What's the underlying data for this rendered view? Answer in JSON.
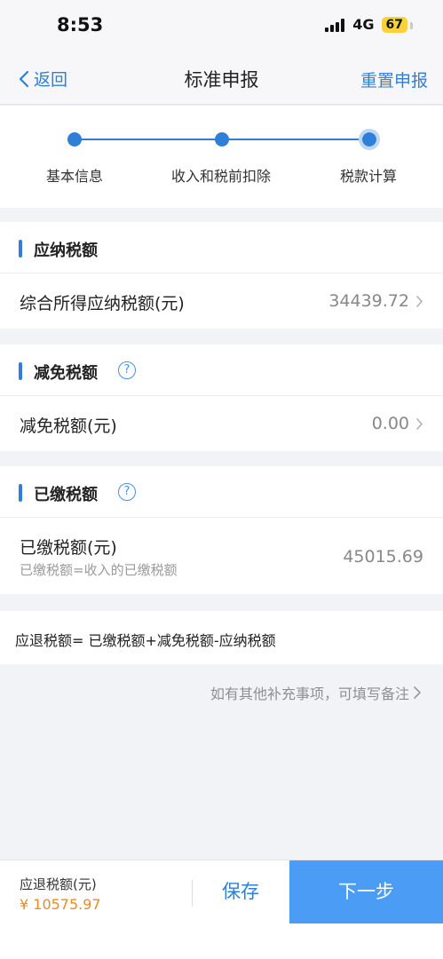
{
  "status_bar": {
    "time": "8:53",
    "network": "4G",
    "battery": "67"
  },
  "nav": {
    "back_label": "返回",
    "title": "标准申报",
    "reset_label": "重置申报"
  },
  "steps": [
    {
      "label": "基本信息"
    },
    {
      "label": "收入和税前扣除"
    },
    {
      "label": "税款计算"
    }
  ],
  "sections": {
    "payable": {
      "title": "应纳税额",
      "row_label": "综合所得应纳税额(元)",
      "row_value": "34439.72"
    },
    "relief": {
      "title": "减免税额",
      "help": "?",
      "row_label": "减免税额(元)",
      "row_value": "0.00"
    },
    "paid": {
      "title": "已缴税额",
      "help": "?",
      "row_label": "已缴税额(元)",
      "row_sub": "已缴税额=收入的已缴税额",
      "row_value": "45015.69"
    }
  },
  "formula": "应退税额= 已缴税额+减免税额-应纳税额",
  "note_link": "如有其他补充事项，可填写备注",
  "bottom": {
    "label": "应退税额(元)",
    "amount": "¥ 10575.97",
    "save_label": "保存",
    "next_label": "下一步"
  },
  "colors": {
    "accent": "#2f7fd9",
    "button": "#4b9cf5",
    "amount": "#f08a1c"
  }
}
